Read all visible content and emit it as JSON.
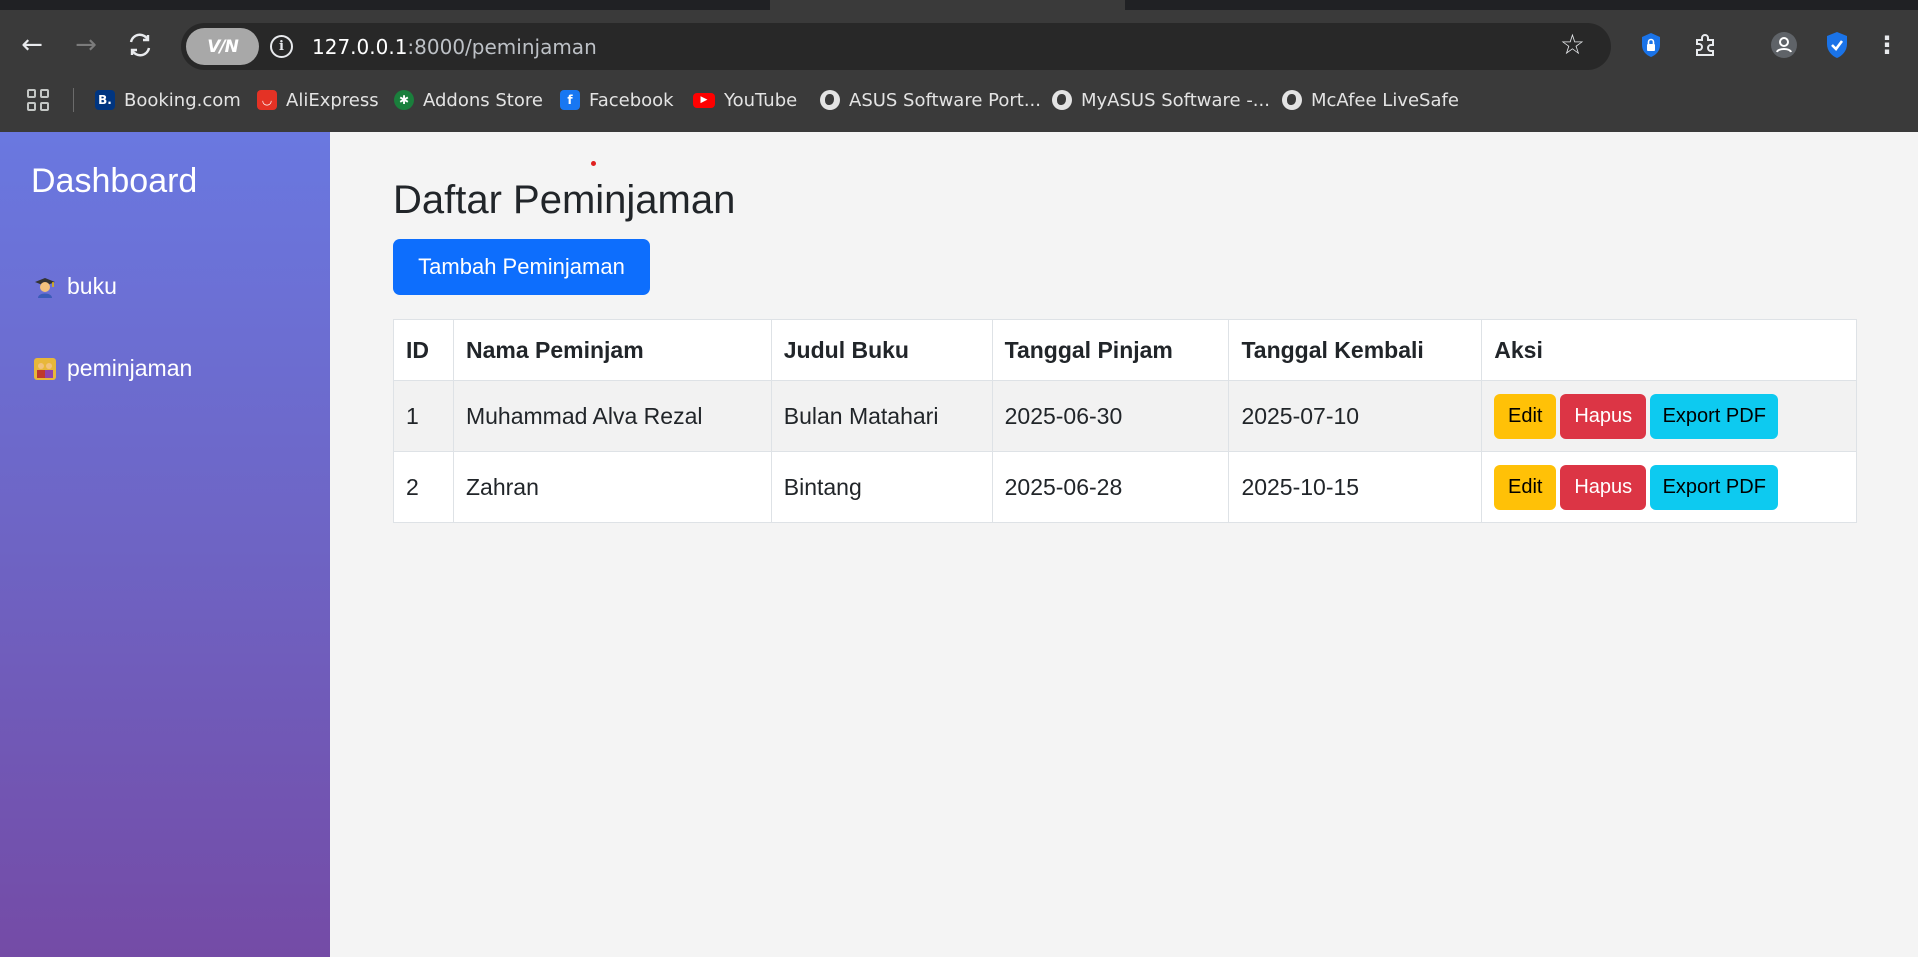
{
  "browser": {
    "vpn_label": "V/N",
    "url_host": "127.0.0.1",
    "url_path": ":8000/peminjaman",
    "bookmarks": [
      {
        "label": "Booking.com",
        "icon": "booking-icon",
        "color": "#003580"
      },
      {
        "label": "AliExpress",
        "icon": "aliexpress-icon",
        "color": "#e43225"
      },
      {
        "label": "Addons Store",
        "icon": "addons-store-icon",
        "color": "#1a7f3c"
      },
      {
        "label": "Facebook",
        "icon": "facebook-icon",
        "color": "#1877f2"
      },
      {
        "label": "YouTube",
        "icon": "youtube-icon",
        "color": "#ff0000"
      },
      {
        "label": "ASUS Software Port...",
        "icon": "globe-icon",
        "color": "#e3e3e3"
      },
      {
        "label": "MyASUS Software -...",
        "icon": "globe-icon",
        "color": "#e3e3e3"
      },
      {
        "label": "McAfee LiveSafe",
        "icon": "globe-icon",
        "color": "#e3e3e3"
      }
    ]
  },
  "sidebar": {
    "brand": "Dashboard",
    "items": [
      {
        "label": "buku",
        "icon": "student-emoji-icon"
      },
      {
        "label": "peminjaman",
        "icon": "people-emoji-icon"
      }
    ]
  },
  "main": {
    "title": "Daftar Peminjaman",
    "add_button": "Tambah Peminjaman",
    "table": {
      "headers": [
        "ID",
        "Nama Peminjam",
        "Judul Buku",
        "Tanggal Pinjam",
        "Tanggal Kembali",
        "Aksi"
      ],
      "rows": [
        {
          "id": "1",
          "nama": "Muhammad Alva Rezal",
          "judul": "Bulan Matahari",
          "tanggal_pinjam": "2025-06-30",
          "tanggal_kembali": "2025-07-10"
        },
        {
          "id": "2",
          "nama": "Zahran",
          "judul": "Bintang",
          "tanggal_pinjam": "2025-06-28",
          "tanggal_kembali": "2025-10-15"
        }
      ],
      "actions": {
        "edit": "Edit",
        "hapus": "Hapus",
        "export": "Export PDF"
      }
    }
  },
  "colors": {
    "primary": "#0d6efd",
    "warning": "#ffc107",
    "danger": "#dc3545",
    "info": "#0dcaf0"
  }
}
